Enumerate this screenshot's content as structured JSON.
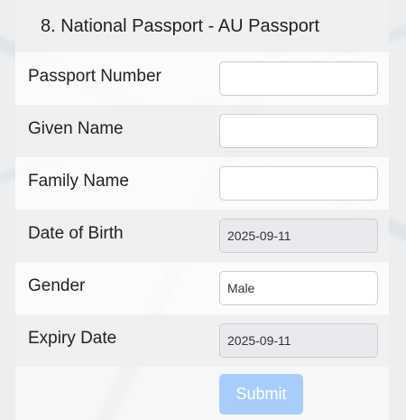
{
  "form": {
    "title": "8. National Passport - AU Passport",
    "fields": [
      {
        "label": "Passport Number",
        "value": "",
        "readonly": false
      },
      {
        "label": "Given Name",
        "value": "",
        "readonly": false
      },
      {
        "label": "Family Name",
        "value": "",
        "readonly": false
      },
      {
        "label": "Date of Birth",
        "value": "2025-09-11",
        "readonly": true
      },
      {
        "label": "Gender",
        "value": "Male",
        "readonly": false
      },
      {
        "label": "Expiry Date",
        "value": "2025-09-11",
        "readonly": true
      }
    ],
    "submit_label": "Submit"
  },
  "colors": {
    "submit_disabled": "#a9cdfa",
    "row_shaded": "#eeeeee",
    "readonly_field": "#e8eaed"
  }
}
